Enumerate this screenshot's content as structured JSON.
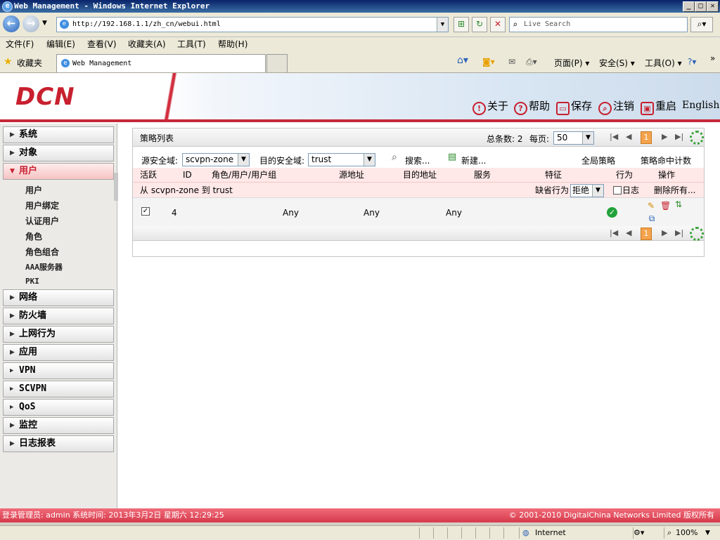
{
  "window": {
    "title": "Web Management - Windows Internet Explorer",
    "min": "_",
    "max": "□",
    "close": "✕"
  },
  "browser": {
    "url": "http://192.168.1.1/zh_cn/webui.html",
    "search_placeholder": "Live Search",
    "menu": [
      "文件(F)",
      "编辑(E)",
      "查看(V)",
      "收藏夹(A)",
      "工具(T)",
      "帮助(H)"
    ],
    "favorites_label": "收藏夹",
    "tab_title": "Web Management",
    "commands": [
      "页面(P)",
      "安全(S)",
      "工具(O)"
    ],
    "status_zone": "Internet",
    "zoom": "100%"
  },
  "header": {
    "logo": "DCN",
    "links": [
      {
        "icon": "!",
        "label": "关于"
      },
      {
        "icon": "?",
        "label": "帮助"
      },
      {
        "icon": "▭",
        "label": "保存"
      },
      {
        "icon": "⌕",
        "label": "注销"
      },
      {
        "icon": "▣",
        "label": "重启"
      }
    ],
    "language": "English"
  },
  "sidebar": {
    "top_items": [
      "系统",
      "对象"
    ],
    "active": "用户",
    "subitems": [
      "用户",
      "用户绑定",
      "认证用户",
      "角色",
      "角色组合",
      "AAA服务器",
      "PKI"
    ],
    "bottom_items": [
      "网络",
      "防火墙",
      "上网行为",
      "应用",
      "VPN",
      "SCVPN",
      "QoS",
      "监控",
      "日志报表"
    ]
  },
  "panel": {
    "title": "策略列表",
    "total_label": "总条数: 2",
    "per_page_label": "每页:",
    "per_page_value": "50",
    "page": "1",
    "src_zone_label": "源安全域:",
    "src_zone_value": "scvpn-zone",
    "dst_zone_label": "目的安全域:",
    "dst_zone_value": "trust",
    "search_label": "搜索...",
    "new_label": "新建...",
    "global_policy": "全局策略",
    "hit_count": "策略命中计数",
    "columns": [
      "活跃",
      "ID",
      "角色/用户/用户组",
      "源地址",
      "目的地址",
      "服务",
      "特征",
      "行为",
      "操作"
    ],
    "group_label": "从 scvpn-zone 到 trust",
    "default_action_label": "缺省行为",
    "default_action_value": "拒绝",
    "log_label": "日志",
    "delete_all": "删除所有...",
    "row": {
      "active": true,
      "id": "4",
      "src": "Any",
      "dst": "Any",
      "service": "Any"
    }
  },
  "status": {
    "left": "登录管理员: admin  系统时间: 2013年3月2日 星期六 12:29:25",
    "right": "© 2001-2010 DigitalChina Networks Limited 版权所有"
  }
}
